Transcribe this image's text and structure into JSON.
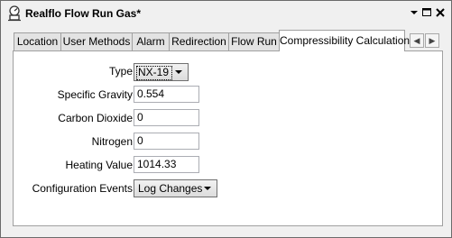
{
  "window": {
    "title": "Realflo Flow Run Gas*",
    "icon": "gas-meter-icon",
    "controls": [
      "dropdown-arrow-icon",
      "maximize-icon",
      "close-icon"
    ]
  },
  "tabs": [
    {
      "label": "Location"
    },
    {
      "label": "User Methods"
    },
    {
      "label": "Alarm"
    },
    {
      "label": "Redirection"
    },
    {
      "label": "Flow Run"
    },
    {
      "label": "Compressibility Calculation",
      "active": true
    }
  ],
  "tab_scroll": {
    "left_icon": "chevron-left-icon",
    "right_icon": "chevron-right-icon"
  },
  "form": {
    "type": {
      "label": "Type",
      "value": "NX-19"
    },
    "specific_gravity": {
      "label": "Specific Gravity",
      "value": "0.554"
    },
    "carbon_dioxide": {
      "label": "Carbon Dioxide",
      "value": "0"
    },
    "nitrogen": {
      "label": "Nitrogen",
      "value": "0"
    },
    "heating_value": {
      "label": "Heating Value",
      "value": "1014.33"
    },
    "configuration_events": {
      "label": "Configuration Events",
      "value": "Log Changes"
    }
  }
}
